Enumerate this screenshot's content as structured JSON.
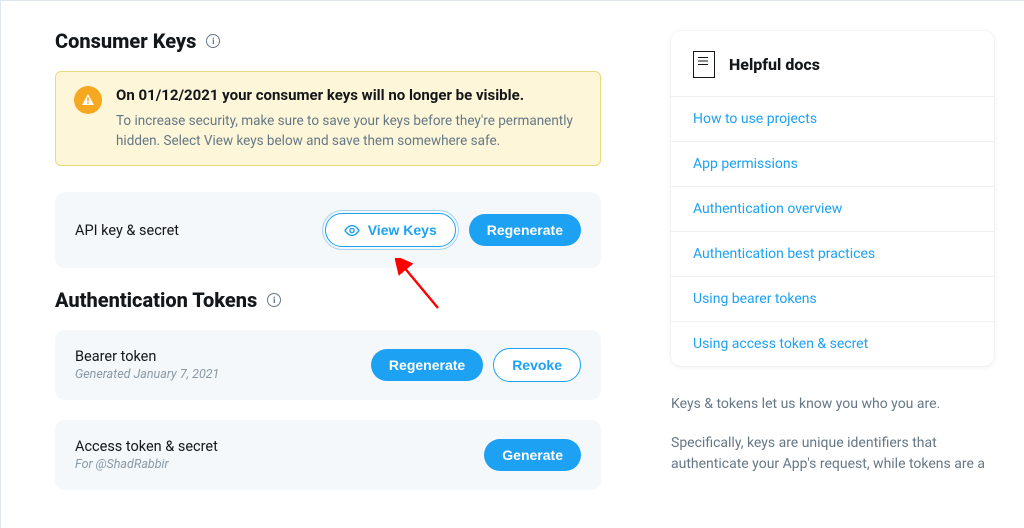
{
  "consumer_keys": {
    "heading": "Consumer Keys",
    "alert": {
      "title": "On 01/12/2021 your consumer keys will no longer be visible.",
      "body": "To increase security, make sure to save your keys before they're permanently hidden. Select View keys below and save them somewhere safe."
    },
    "api_key": {
      "label": "API key & secret",
      "view_btn": "View Keys",
      "regen_btn": "Regenerate"
    }
  },
  "auth_tokens": {
    "heading": "Authentication Tokens",
    "bearer": {
      "label": "Bearer token",
      "sub": "Generated January 7, 2021",
      "regen_btn": "Regenerate",
      "revoke_btn": "Revoke"
    },
    "access": {
      "label": "Access token & secret",
      "sub": "For @ShadRabbir",
      "gen_btn": "Generate"
    }
  },
  "docs": {
    "heading": "Helpful docs",
    "links": [
      "How to use projects",
      "App permissions",
      "Authentication overview",
      "Authentication best practices",
      "Using bearer tokens",
      "Using access token & secret"
    ],
    "para1": "Keys & tokens let us know you who you are.",
    "para2": "Specifically, keys are unique identifiers that authenticate your App's request, while tokens are a"
  }
}
